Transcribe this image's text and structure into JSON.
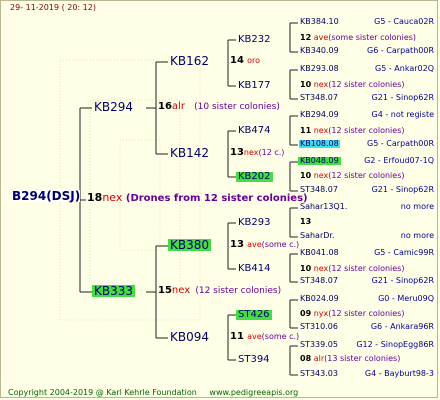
{
  "date": "29- 11-2019 ( 20: 12)",
  "footer": {
    "copyright": "Copyright 2004-2019 @ Karl Kehrle Foundation",
    "url": "www.pedigreeapis.org"
  },
  "root": {
    "label": "B294(DSJ)",
    "num": "18",
    "tag": "nex",
    "note": "(Drones from 12 sister colonies)"
  },
  "gen2": [
    {
      "label": "KB294",
      "num": "16",
      "tag": "alr",
      "note": "(10 sister colonies)"
    },
    {
      "label": "KB333",
      "num": "15",
      "tag": "nex",
      "note": "(12 sister colonies)"
    }
  ],
  "gen3": [
    {
      "label": "KB162",
      "num": "14",
      "tag": "oro",
      "note": ""
    },
    {
      "label": "KB142",
      "num": "13",
      "tag": "nex",
      "note": "(12 c.)"
    },
    {
      "label": "KB380",
      "num": "13",
      "tag": "ave",
      "note": "(some c.)"
    },
    {
      "label": "KB094",
      "num": "11",
      "tag": "ave",
      "note": "(some c.)"
    }
  ],
  "gen4": [
    {
      "label": "KB232",
      "num": "12",
      "tag": "ave",
      "note": "(some sister colonies)"
    },
    {
      "label": "KB177",
      "num": "10",
      "tag": "nex",
      "note": "(12 sister colonies)"
    },
    {
      "label": "KB474",
      "num": "11",
      "tag": "nex",
      "note": "(12 sister colonies)"
    },
    {
      "label": "KB202",
      "num": "10",
      "tag": "nex",
      "note": "(12 sister colonies)"
    },
    {
      "label": "KB293",
      "num": "13",
      "tag": "",
      "note": ""
    },
    {
      "label": "KB414",
      "num": "10",
      "tag": "nex",
      "note": "(12 sister colonies)"
    },
    {
      "label": "ST426",
      "num": "09",
      "tag": "nyx",
      "note": "(12 sister colonies)"
    },
    {
      "label": "ST394",
      "num": "08",
      "tag": "alr",
      "note": "(13 sister colonies)"
    }
  ],
  "gen5": [
    {
      "label": "KB384.10",
      "right": "G5 - Cauca02R"
    },
    {
      "label": "KB340.09",
      "right": "G6 - Carpath00R"
    },
    {
      "label": "KB293.08",
      "right": "G5 - Ankar02Q"
    },
    {
      "label": "ST348.07",
      "right": "G21 - Sinop62R"
    },
    {
      "label": "KB294.09",
      "right": "G4 - not registe"
    },
    {
      "label": "KB108.08",
      "right": "G5 - Carpath00R"
    },
    {
      "label": "KB048.09",
      "right": "G2 - Erfoud07-1Q"
    },
    {
      "label": "ST348.07",
      "right": "G21 - Sinop62R"
    },
    {
      "label": "Sahar13Q1.",
      "right": "no more"
    },
    {
      "label": "SaharDr.",
      "right": "no more"
    },
    {
      "label": "KB041.08",
      "right": "G5 - Camic99R"
    },
    {
      "label": "ST348.07",
      "right": "G21 - Sinop62R"
    },
    {
      "label": "KB024.09",
      "right": "G0 - Meru09Q"
    },
    {
      "label": "ST310.06",
      "right": "G6 - Ankara96R"
    },
    {
      "label": "ST339.05",
      "right": "G12 - SinopEgg86R"
    },
    {
      "label": "ST343.03",
      "right": "G4 - Bayburt98-3"
    }
  ]
}
